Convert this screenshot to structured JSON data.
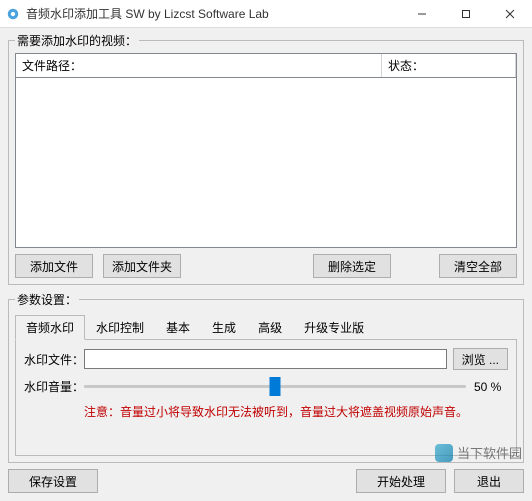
{
  "window": {
    "title": "音频水印添加工具 SW by Lizcst Software Lab"
  },
  "groups": {
    "videos_legend": "需要添加水印的视频：",
    "settings_legend": "参数设置："
  },
  "columns": {
    "path": "文件路径：",
    "status": "状态："
  },
  "buttons": {
    "add_file": "添加文件",
    "add_folder": "添加文件夹",
    "remove_selected": "删除选定",
    "clear_all": "清空全部",
    "browse": "浏览 ...",
    "save_settings": "保存设置",
    "start": "开始处理",
    "exit": "退出"
  },
  "tabs": {
    "audio_wm": "音频水印",
    "wm_control": "水印控制",
    "basic": "基本",
    "generate": "生成",
    "advanced": "高级",
    "upgrade": "升级专业版"
  },
  "form": {
    "file_label": "水印文件：",
    "file_value": "",
    "volume_label": "水印音量：",
    "volume_value": "50 %",
    "warning": "注意：音量过小将导致水印无法被听到，音量过大将遮盖视频原始声音。"
  },
  "watermark": {
    "text": "当下软件园"
  }
}
